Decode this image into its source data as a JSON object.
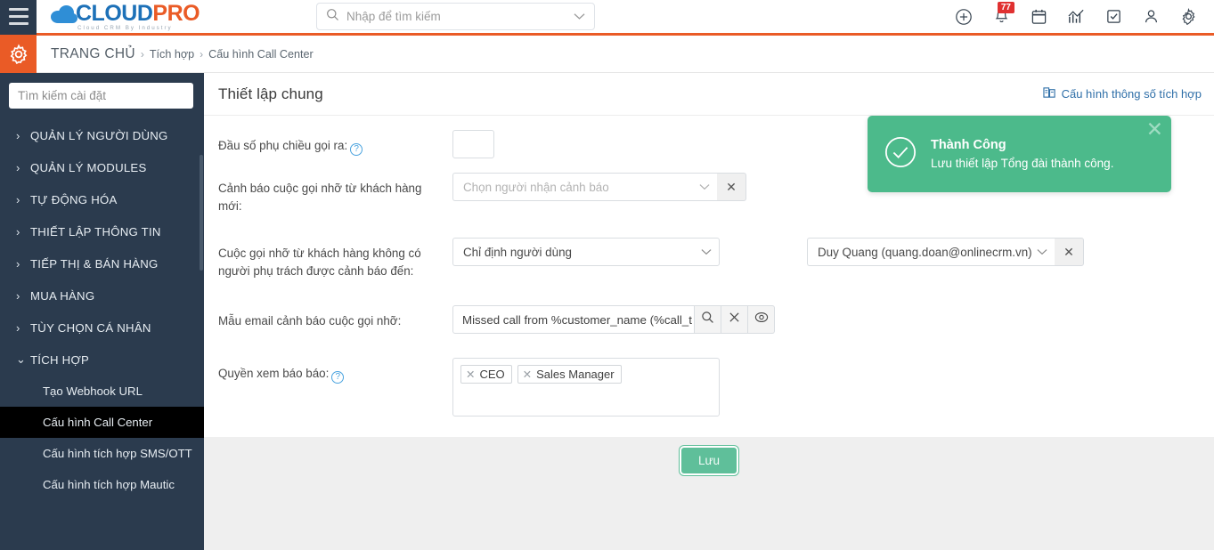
{
  "topbar": {
    "menu_icon": "hamburger-icon",
    "logo": {
      "part1": "CLOUD",
      "part2": "PRO",
      "tagline": "Cloud CRM By Industry"
    },
    "search": {
      "placeholder": "Nhập để tìm kiếm",
      "icon": "search-icon",
      "chevron": "chevron-down-icon"
    },
    "icons": [
      {
        "name": "add-circle-icon",
        "badge": ""
      },
      {
        "name": "notification-bell-icon",
        "badge": "77"
      },
      {
        "name": "calendar-icon",
        "badge": ""
      },
      {
        "name": "analytics-chart-icon",
        "badge": ""
      },
      {
        "name": "task-checkbox-icon",
        "badge": ""
      },
      {
        "name": "user-profile-icon",
        "badge": ""
      },
      {
        "name": "settings-gear-icon",
        "badge": ""
      }
    ]
  },
  "breadcrumb": {
    "gear_icon": "settings-gear-icon",
    "home": "TRANG CHỦ",
    "separator": "›",
    "middle": "Tích hợp",
    "current": "Cấu hình Call Center"
  },
  "sidebar": {
    "search_placeholder": "Tìm kiếm cài đặt",
    "groups": [
      {
        "label": "QUẢN LÝ NGƯỜI DÙNG",
        "expanded": false
      },
      {
        "label": "QUẢN LÝ MODULES",
        "expanded": false
      },
      {
        "label": "TỰ ĐỘNG HÓA",
        "expanded": false
      },
      {
        "label": "THIẾT LẬP THÔNG TIN",
        "expanded": false
      },
      {
        "label": "TIẾP THỊ & BÁN HÀNG",
        "expanded": false
      },
      {
        "label": "MUA HÀNG",
        "expanded": false
      },
      {
        "label": "TÙY CHỌN CÁ NHÂN",
        "expanded": false
      },
      {
        "label": "TÍCH HỢP",
        "expanded": true
      }
    ],
    "sub_items": [
      {
        "label": "Tạo Webhook URL",
        "active": false
      },
      {
        "label": "Cấu hình Call Center",
        "active": true
      },
      {
        "label": "Cấu hình tích hợp SMS/OTT",
        "active": false
      },
      {
        "label": "Cấu hình tích hợp Mautic",
        "active": false
      }
    ],
    "collapse_arrow": "›",
    "expand_arrow": "⌄"
  },
  "card": {
    "title": "Thiết lập chung",
    "link_label": "Cấu hình thông số tích hợp",
    "link_icon": "integration-params-icon"
  },
  "form": {
    "field1": {
      "label": "Đầu số phụ chiều gọi ra:",
      "has_help": true,
      "value": ""
    },
    "field2": {
      "label": "Cảnh báo cuộc gọi nhỡ từ khách hàng mới:",
      "placeholder": "Chọn người nhận cảnh báo",
      "value": "",
      "clear_label": "✕"
    },
    "field3": {
      "label": "Cuộc gọi nhỡ từ khách hàng không có người phụ trách được cảnh báo đến:",
      "value": "Chỉ định người dùng",
      "assignee_value": "Duy Quang (quang.doan@onlinecrm.vn)",
      "clear_label": "✕"
    },
    "field4": {
      "label": "Mẫu email cảnh báo cuộc gọi nhỡ:",
      "value": "Missed call from %customer_name (%call_t",
      "search_icon": "search-icon",
      "clear_icon": "close-icon",
      "preview_icon": "eye-icon"
    },
    "field5": {
      "label": "Quyền xem báo báo:",
      "has_help": true,
      "tags": [
        "CEO",
        "Sales Manager"
      ],
      "tag_remove": "✕"
    }
  },
  "footer": {
    "save_label": "Lưu"
  },
  "toast": {
    "title": "Thành Công",
    "message": "Lưu thiết lập Tổng đài thành công.",
    "icon": "check-circle-icon",
    "close_label": "✕",
    "color": "#4cba8b"
  }
}
